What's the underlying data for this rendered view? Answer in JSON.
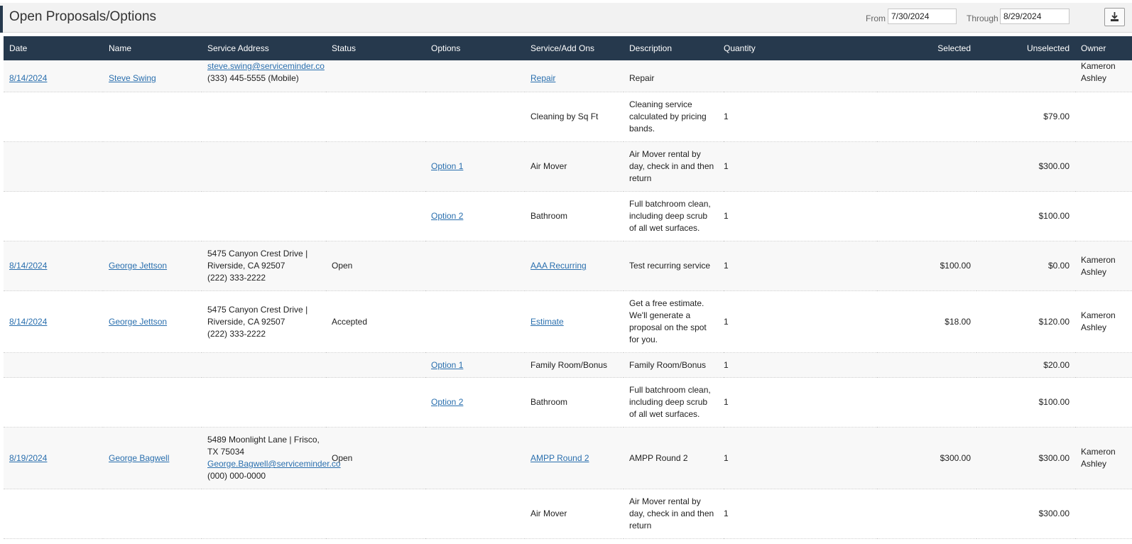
{
  "header": {
    "title": "Open Proposals/Options",
    "from_label": "From",
    "from_value": "7/30/2024",
    "through_label": "Through",
    "through_value": "8/29/2024",
    "download_icon": "download-icon"
  },
  "columns": [
    "Date",
    "Name",
    "Service Address",
    "Status",
    "Options",
    "Service/Add Ons",
    "Description",
    "Quantity",
    "Selected",
    "Unselected",
    "Owner"
  ],
  "rows": [
    {
      "date": "8/14/2024",
      "name": "Steve Swing",
      "addr1": "steve.swing@serviceminder.co",
      "addr2": "(333) 445-5555 (Mobile)",
      "addr3": "",
      "status": "",
      "option": "",
      "service": "Repair",
      "service_link": true,
      "desc": "Repair",
      "qty": "",
      "selected": "",
      "unselected": "",
      "owner": "Kameron Ashley"
    },
    {
      "date": "",
      "name": "",
      "addr1": "",
      "addr2": "",
      "addr3": "",
      "status": "",
      "option": "",
      "service": "Cleaning by Sq Ft",
      "service_link": false,
      "desc": "Cleaning service calculated by pricing bands.",
      "qty": "1",
      "selected": "",
      "unselected": "$79.00",
      "owner": ""
    },
    {
      "date": "",
      "name": "",
      "addr1": "",
      "addr2": "",
      "addr3": "",
      "status": "",
      "option": "Option 1",
      "service": "Air Mover",
      "service_link": false,
      "desc": "Air Mover rental by day, check in and then return",
      "qty": "1",
      "selected": "",
      "unselected": "$300.00",
      "owner": ""
    },
    {
      "date": "",
      "name": "",
      "addr1": "",
      "addr2": "",
      "addr3": "",
      "status": "",
      "option": "Option 2",
      "service": "Bathroom",
      "service_link": false,
      "desc": "Full batchroom clean, including deep scrub of all wet surfaces.",
      "qty": "1",
      "selected": "",
      "unselected": "$100.00",
      "owner": ""
    },
    {
      "date": "8/14/2024",
      "name": "George Jettson",
      "addr1": "5475 Canyon Crest Drive | Riverside, CA 92507",
      "addr2": "(222) 333-2222",
      "addr3": "",
      "status": "Open",
      "option": "",
      "service": "AAA Recurring",
      "service_link": true,
      "desc": "Test recurring service",
      "qty": "1",
      "selected": "$100.00",
      "unselected": "$0.00",
      "owner": "Kameron Ashley"
    },
    {
      "date": "8/14/2024",
      "name": "George Jettson",
      "addr1": "5475 Canyon Crest Drive | Riverside, CA 92507",
      "addr2": "(222) 333-2222",
      "addr3": "",
      "status": "Accepted",
      "option": "",
      "service": "Estimate",
      "service_link": true,
      "desc": "Get a free estimate. We'll generate a proposal on the spot for you.",
      "qty": "1",
      "selected": "$18.00",
      "unselected": "$120.00",
      "owner": "Kameron Ashley"
    },
    {
      "date": "",
      "name": "",
      "addr1": "",
      "addr2": "",
      "addr3": "",
      "status": "",
      "option": "Option 1",
      "service": "Family Room/Bonus",
      "service_link": false,
      "desc": "Family Room/Bonus",
      "qty": "1",
      "selected": "",
      "unselected": "$20.00",
      "owner": ""
    },
    {
      "date": "",
      "name": "",
      "addr1": "",
      "addr2": "",
      "addr3": "",
      "status": "",
      "option": "Option 2",
      "service": "Bathroom",
      "service_link": false,
      "desc": "Full batchroom clean, including deep scrub of all wet surfaces.",
      "qty": "1",
      "selected": "",
      "unselected": "$100.00",
      "owner": ""
    },
    {
      "date": "8/19/2024",
      "name": "George Bagwell",
      "addr1": "5489 Moonlight Lane | Frisco, TX 75034",
      "addr2": "George.Bagwell@serviceminder.co",
      "addr3": "(000) 000-0000",
      "status": "Open",
      "option": "",
      "service": "AMPP Round 2",
      "service_link": true,
      "desc": "AMPP Round 2",
      "qty": "1",
      "selected": "$300.00",
      "unselected": "$300.00",
      "owner": "Kameron Ashley"
    },
    {
      "date": "",
      "name": "",
      "addr1": "",
      "addr2": "",
      "addr3": "",
      "status": "",
      "option": "",
      "service": "Air Mover",
      "service_link": false,
      "desc": "Air Mover rental by day, check in and then return",
      "qty": "1",
      "selected": "",
      "unselected": "$300.00",
      "owner": ""
    }
  ]
}
